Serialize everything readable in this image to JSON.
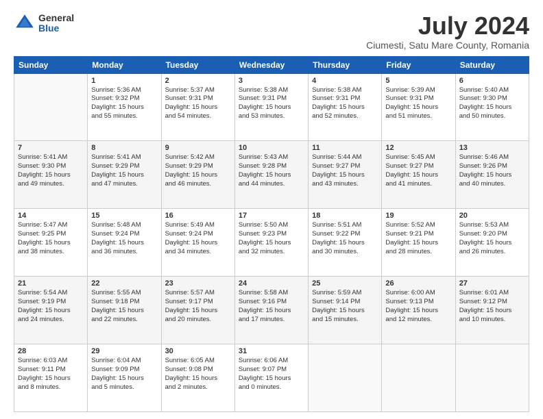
{
  "header": {
    "logo_general": "General",
    "logo_blue": "Blue",
    "title": "July 2024",
    "subtitle": "Ciumesti, Satu Mare County, Romania"
  },
  "weekdays": [
    "Sunday",
    "Monday",
    "Tuesday",
    "Wednesday",
    "Thursday",
    "Friday",
    "Saturday"
  ],
  "weeks": [
    [
      {
        "day": "",
        "info": ""
      },
      {
        "day": "1",
        "info": "Sunrise: 5:36 AM\nSunset: 9:32 PM\nDaylight: 15 hours\nand 55 minutes."
      },
      {
        "day": "2",
        "info": "Sunrise: 5:37 AM\nSunset: 9:31 PM\nDaylight: 15 hours\nand 54 minutes."
      },
      {
        "day": "3",
        "info": "Sunrise: 5:38 AM\nSunset: 9:31 PM\nDaylight: 15 hours\nand 53 minutes."
      },
      {
        "day": "4",
        "info": "Sunrise: 5:38 AM\nSunset: 9:31 PM\nDaylight: 15 hours\nand 52 minutes."
      },
      {
        "day": "5",
        "info": "Sunrise: 5:39 AM\nSunset: 9:31 PM\nDaylight: 15 hours\nand 51 minutes."
      },
      {
        "day": "6",
        "info": "Sunrise: 5:40 AM\nSunset: 9:30 PM\nDaylight: 15 hours\nand 50 minutes."
      }
    ],
    [
      {
        "day": "7",
        "info": "Sunrise: 5:41 AM\nSunset: 9:30 PM\nDaylight: 15 hours\nand 49 minutes."
      },
      {
        "day": "8",
        "info": "Sunrise: 5:41 AM\nSunset: 9:29 PM\nDaylight: 15 hours\nand 47 minutes."
      },
      {
        "day": "9",
        "info": "Sunrise: 5:42 AM\nSunset: 9:29 PM\nDaylight: 15 hours\nand 46 minutes."
      },
      {
        "day": "10",
        "info": "Sunrise: 5:43 AM\nSunset: 9:28 PM\nDaylight: 15 hours\nand 44 minutes."
      },
      {
        "day": "11",
        "info": "Sunrise: 5:44 AM\nSunset: 9:27 PM\nDaylight: 15 hours\nand 43 minutes."
      },
      {
        "day": "12",
        "info": "Sunrise: 5:45 AM\nSunset: 9:27 PM\nDaylight: 15 hours\nand 41 minutes."
      },
      {
        "day": "13",
        "info": "Sunrise: 5:46 AM\nSunset: 9:26 PM\nDaylight: 15 hours\nand 40 minutes."
      }
    ],
    [
      {
        "day": "14",
        "info": "Sunrise: 5:47 AM\nSunset: 9:25 PM\nDaylight: 15 hours\nand 38 minutes."
      },
      {
        "day": "15",
        "info": "Sunrise: 5:48 AM\nSunset: 9:24 PM\nDaylight: 15 hours\nand 36 minutes."
      },
      {
        "day": "16",
        "info": "Sunrise: 5:49 AM\nSunset: 9:24 PM\nDaylight: 15 hours\nand 34 minutes."
      },
      {
        "day": "17",
        "info": "Sunrise: 5:50 AM\nSunset: 9:23 PM\nDaylight: 15 hours\nand 32 minutes."
      },
      {
        "day": "18",
        "info": "Sunrise: 5:51 AM\nSunset: 9:22 PM\nDaylight: 15 hours\nand 30 minutes."
      },
      {
        "day": "19",
        "info": "Sunrise: 5:52 AM\nSunset: 9:21 PM\nDaylight: 15 hours\nand 28 minutes."
      },
      {
        "day": "20",
        "info": "Sunrise: 5:53 AM\nSunset: 9:20 PM\nDaylight: 15 hours\nand 26 minutes."
      }
    ],
    [
      {
        "day": "21",
        "info": "Sunrise: 5:54 AM\nSunset: 9:19 PM\nDaylight: 15 hours\nand 24 minutes."
      },
      {
        "day": "22",
        "info": "Sunrise: 5:55 AM\nSunset: 9:18 PM\nDaylight: 15 hours\nand 22 minutes."
      },
      {
        "day": "23",
        "info": "Sunrise: 5:57 AM\nSunset: 9:17 PM\nDaylight: 15 hours\nand 20 minutes."
      },
      {
        "day": "24",
        "info": "Sunrise: 5:58 AM\nSunset: 9:16 PM\nDaylight: 15 hours\nand 17 minutes."
      },
      {
        "day": "25",
        "info": "Sunrise: 5:59 AM\nSunset: 9:14 PM\nDaylight: 15 hours\nand 15 minutes."
      },
      {
        "day": "26",
        "info": "Sunrise: 6:00 AM\nSunset: 9:13 PM\nDaylight: 15 hours\nand 12 minutes."
      },
      {
        "day": "27",
        "info": "Sunrise: 6:01 AM\nSunset: 9:12 PM\nDaylight: 15 hours\nand 10 minutes."
      }
    ],
    [
      {
        "day": "28",
        "info": "Sunrise: 6:03 AM\nSunset: 9:11 PM\nDaylight: 15 hours\nand 8 minutes."
      },
      {
        "day": "29",
        "info": "Sunrise: 6:04 AM\nSunset: 9:09 PM\nDaylight: 15 hours\nand 5 minutes."
      },
      {
        "day": "30",
        "info": "Sunrise: 6:05 AM\nSunset: 9:08 PM\nDaylight: 15 hours\nand 2 minutes."
      },
      {
        "day": "31",
        "info": "Sunrise: 6:06 AM\nSunset: 9:07 PM\nDaylight: 15 hours\nand 0 minutes."
      },
      {
        "day": "",
        "info": ""
      },
      {
        "day": "",
        "info": ""
      },
      {
        "day": "",
        "info": ""
      }
    ]
  ]
}
